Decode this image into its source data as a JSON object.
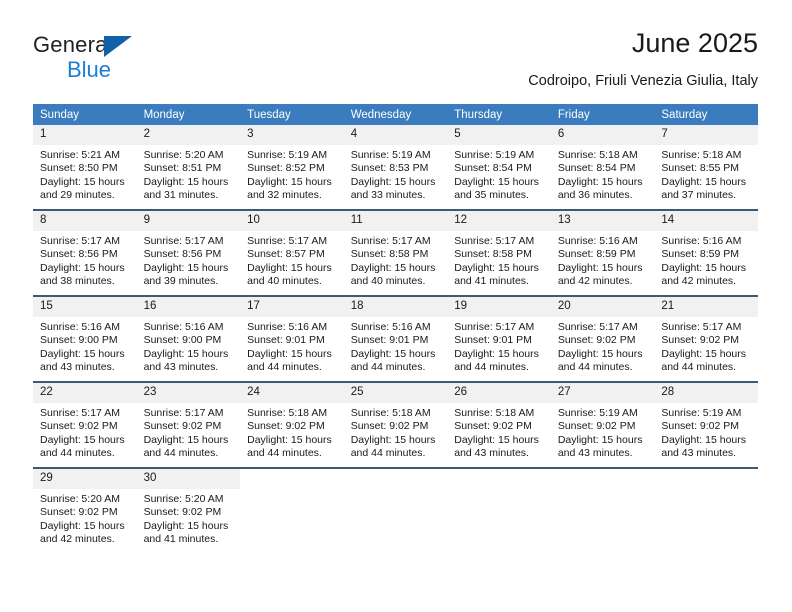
{
  "brand": {
    "name_part1": "General",
    "name_part2": "Blue",
    "triangle_icon": "blue-triangle-logo-icon",
    "accent_color": "#1b7fd4",
    "triangle_color": "#1061a8"
  },
  "header": {
    "title": "June 2025",
    "subtitle": "Codroipo, Friuli Venezia Giulia, Italy"
  },
  "calendar": {
    "header_bg": "#3a7cbe",
    "header_text_color": "#ffffff",
    "daynum_bg": "#f1f1f1",
    "row_rule_color": "#3c5a74",
    "weekday_headers": [
      "Sunday",
      "Monday",
      "Tuesday",
      "Wednesday",
      "Thursday",
      "Friday",
      "Saturday"
    ],
    "weeks": [
      [
        {
          "day": "1",
          "sunrise": "Sunrise: 5:21 AM",
          "sunset": "Sunset: 8:50 PM",
          "daylight_line1": "Daylight: 15 hours",
          "daylight_line2": "and 29 minutes."
        },
        {
          "day": "2",
          "sunrise": "Sunrise: 5:20 AM",
          "sunset": "Sunset: 8:51 PM",
          "daylight_line1": "Daylight: 15 hours",
          "daylight_line2": "and 31 minutes."
        },
        {
          "day": "3",
          "sunrise": "Sunrise: 5:19 AM",
          "sunset": "Sunset: 8:52 PM",
          "daylight_line1": "Daylight: 15 hours",
          "daylight_line2": "and 32 minutes."
        },
        {
          "day": "4",
          "sunrise": "Sunrise: 5:19 AM",
          "sunset": "Sunset: 8:53 PM",
          "daylight_line1": "Daylight: 15 hours",
          "daylight_line2": "and 33 minutes."
        },
        {
          "day": "5",
          "sunrise": "Sunrise: 5:19 AM",
          "sunset": "Sunset: 8:54 PM",
          "daylight_line1": "Daylight: 15 hours",
          "daylight_line2": "and 35 minutes."
        },
        {
          "day": "6",
          "sunrise": "Sunrise: 5:18 AM",
          "sunset": "Sunset: 8:54 PM",
          "daylight_line1": "Daylight: 15 hours",
          "daylight_line2": "and 36 minutes."
        },
        {
          "day": "7",
          "sunrise": "Sunrise: 5:18 AM",
          "sunset": "Sunset: 8:55 PM",
          "daylight_line1": "Daylight: 15 hours",
          "daylight_line2": "and 37 minutes."
        }
      ],
      [
        {
          "day": "8",
          "sunrise": "Sunrise: 5:17 AM",
          "sunset": "Sunset: 8:56 PM",
          "daylight_line1": "Daylight: 15 hours",
          "daylight_line2": "and 38 minutes."
        },
        {
          "day": "9",
          "sunrise": "Sunrise: 5:17 AM",
          "sunset": "Sunset: 8:56 PM",
          "daylight_line1": "Daylight: 15 hours",
          "daylight_line2": "and 39 minutes."
        },
        {
          "day": "10",
          "sunrise": "Sunrise: 5:17 AM",
          "sunset": "Sunset: 8:57 PM",
          "daylight_line1": "Daylight: 15 hours",
          "daylight_line2": "and 40 minutes."
        },
        {
          "day": "11",
          "sunrise": "Sunrise: 5:17 AM",
          "sunset": "Sunset: 8:58 PM",
          "daylight_line1": "Daylight: 15 hours",
          "daylight_line2": "and 40 minutes."
        },
        {
          "day": "12",
          "sunrise": "Sunrise: 5:17 AM",
          "sunset": "Sunset: 8:58 PM",
          "daylight_line1": "Daylight: 15 hours",
          "daylight_line2": "and 41 minutes."
        },
        {
          "day": "13",
          "sunrise": "Sunrise: 5:16 AM",
          "sunset": "Sunset: 8:59 PM",
          "daylight_line1": "Daylight: 15 hours",
          "daylight_line2": "and 42 minutes."
        },
        {
          "day": "14",
          "sunrise": "Sunrise: 5:16 AM",
          "sunset": "Sunset: 8:59 PM",
          "daylight_line1": "Daylight: 15 hours",
          "daylight_line2": "and 42 minutes."
        }
      ],
      [
        {
          "day": "15",
          "sunrise": "Sunrise: 5:16 AM",
          "sunset": "Sunset: 9:00 PM",
          "daylight_line1": "Daylight: 15 hours",
          "daylight_line2": "and 43 minutes."
        },
        {
          "day": "16",
          "sunrise": "Sunrise: 5:16 AM",
          "sunset": "Sunset: 9:00 PM",
          "daylight_line1": "Daylight: 15 hours",
          "daylight_line2": "and 43 minutes."
        },
        {
          "day": "17",
          "sunrise": "Sunrise: 5:16 AM",
          "sunset": "Sunset: 9:01 PM",
          "daylight_line1": "Daylight: 15 hours",
          "daylight_line2": "and 44 minutes."
        },
        {
          "day": "18",
          "sunrise": "Sunrise: 5:16 AM",
          "sunset": "Sunset: 9:01 PM",
          "daylight_line1": "Daylight: 15 hours",
          "daylight_line2": "and 44 minutes."
        },
        {
          "day": "19",
          "sunrise": "Sunrise: 5:17 AM",
          "sunset": "Sunset: 9:01 PM",
          "daylight_line1": "Daylight: 15 hours",
          "daylight_line2": "and 44 minutes."
        },
        {
          "day": "20",
          "sunrise": "Sunrise: 5:17 AM",
          "sunset": "Sunset: 9:02 PM",
          "daylight_line1": "Daylight: 15 hours",
          "daylight_line2": "and 44 minutes."
        },
        {
          "day": "21",
          "sunrise": "Sunrise: 5:17 AM",
          "sunset": "Sunset: 9:02 PM",
          "daylight_line1": "Daylight: 15 hours",
          "daylight_line2": "and 44 minutes."
        }
      ],
      [
        {
          "day": "22",
          "sunrise": "Sunrise: 5:17 AM",
          "sunset": "Sunset: 9:02 PM",
          "daylight_line1": "Daylight: 15 hours",
          "daylight_line2": "and 44 minutes."
        },
        {
          "day": "23",
          "sunrise": "Sunrise: 5:17 AM",
          "sunset": "Sunset: 9:02 PM",
          "daylight_line1": "Daylight: 15 hours",
          "daylight_line2": "and 44 minutes."
        },
        {
          "day": "24",
          "sunrise": "Sunrise: 5:18 AM",
          "sunset": "Sunset: 9:02 PM",
          "daylight_line1": "Daylight: 15 hours",
          "daylight_line2": "and 44 minutes."
        },
        {
          "day": "25",
          "sunrise": "Sunrise: 5:18 AM",
          "sunset": "Sunset: 9:02 PM",
          "daylight_line1": "Daylight: 15 hours",
          "daylight_line2": "and 44 minutes."
        },
        {
          "day": "26",
          "sunrise": "Sunrise: 5:18 AM",
          "sunset": "Sunset: 9:02 PM",
          "daylight_line1": "Daylight: 15 hours",
          "daylight_line2": "and 43 minutes."
        },
        {
          "day": "27",
          "sunrise": "Sunrise: 5:19 AM",
          "sunset": "Sunset: 9:02 PM",
          "daylight_line1": "Daylight: 15 hours",
          "daylight_line2": "and 43 minutes."
        },
        {
          "day": "28",
          "sunrise": "Sunrise: 5:19 AM",
          "sunset": "Sunset: 9:02 PM",
          "daylight_line1": "Daylight: 15 hours",
          "daylight_line2": "and 43 minutes."
        }
      ],
      [
        {
          "day": "29",
          "sunrise": "Sunrise: 5:20 AM",
          "sunset": "Sunset: 9:02 PM",
          "daylight_line1": "Daylight: 15 hours",
          "daylight_line2": "and 42 minutes."
        },
        {
          "day": "30",
          "sunrise": "Sunrise: 5:20 AM",
          "sunset": "Sunset: 9:02 PM",
          "daylight_line1": "Daylight: 15 hours",
          "daylight_line2": "and 41 minutes."
        },
        {
          "day": "",
          "sunrise": "",
          "sunset": "",
          "daylight_line1": "",
          "daylight_line2": ""
        },
        {
          "day": "",
          "sunrise": "",
          "sunset": "",
          "daylight_line1": "",
          "daylight_line2": ""
        },
        {
          "day": "",
          "sunrise": "",
          "sunset": "",
          "daylight_line1": "",
          "daylight_line2": ""
        },
        {
          "day": "",
          "sunrise": "",
          "sunset": "",
          "daylight_line1": "",
          "daylight_line2": ""
        },
        {
          "day": "",
          "sunrise": "",
          "sunset": "",
          "daylight_line1": "",
          "daylight_line2": ""
        }
      ]
    ]
  }
}
